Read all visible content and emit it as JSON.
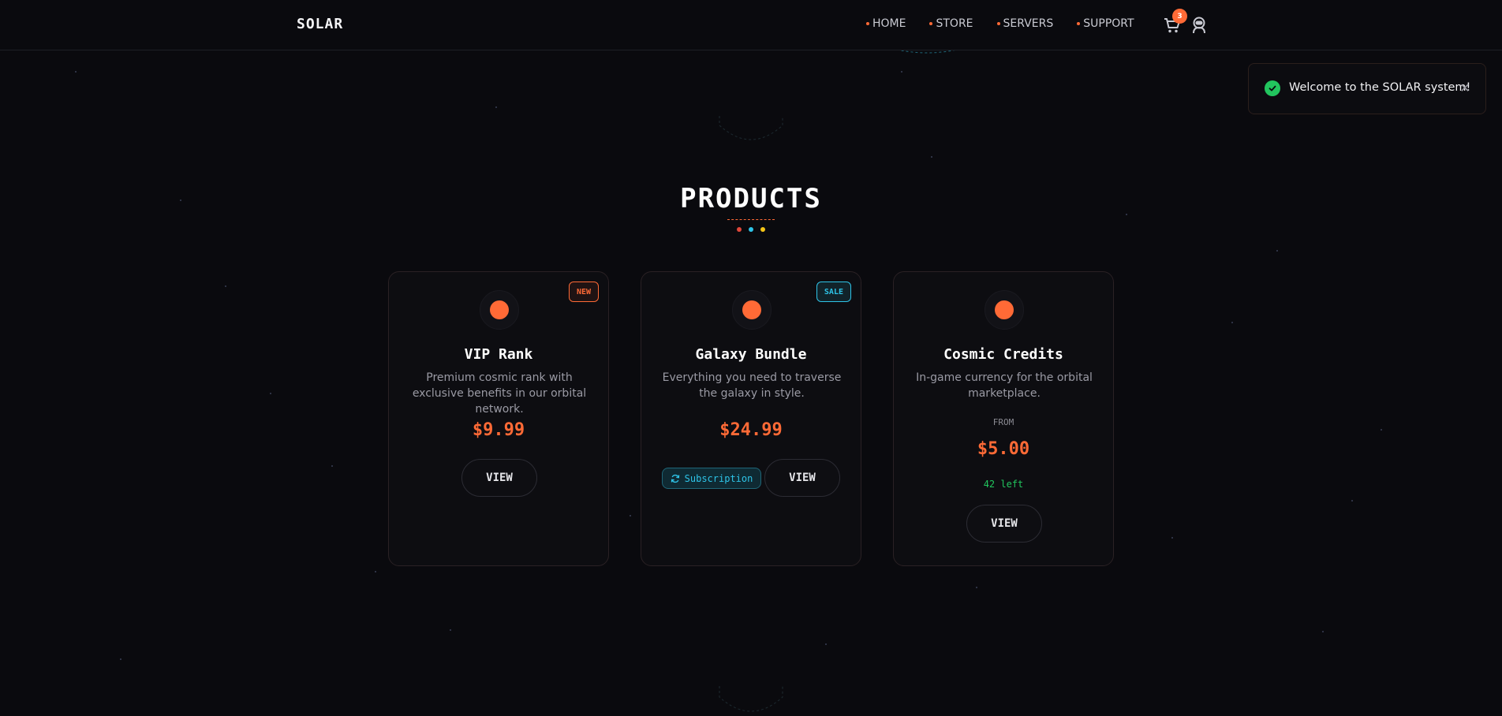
{
  "header": {
    "brand": "SOLAR",
    "nav": [
      {
        "label": "HOME"
      },
      {
        "label": "STORE"
      },
      {
        "label": "SERVERS"
      },
      {
        "label": "SUPPORT"
      }
    ],
    "cart_count": "3",
    "cart_icon": "cart-icon",
    "user_icon": "astronaut-icon"
  },
  "toast": {
    "message": "Welcome to the SOLAR system!",
    "close_label": "✕",
    "status_color": "#22c55e"
  },
  "section": {
    "title": "PRODUCTS",
    "dot_colors": [
      "#e0473a",
      "#2ec4e8",
      "#f5c518"
    ]
  },
  "products": [
    {
      "badge": "NEW",
      "title": "VIP Rank",
      "description": "Premium cosmic rank with exclusive benefits in our orbital network.",
      "price": "$9.99",
      "view_label": "VIEW"
    },
    {
      "badge": "SALE",
      "title": "Galaxy Bundle",
      "description": "Everything you need to traverse the galaxy in style.",
      "price": "$24.99",
      "subscription_label": "Subscription",
      "view_label": "VIEW"
    },
    {
      "title": "Cosmic Credits",
      "description": "In-game currency for the orbital marketplace.",
      "price_prefix": "FROM",
      "price": "$5.00",
      "stock": "42 left",
      "view_label": "VIEW"
    }
  ],
  "colors": {
    "accent": "#ff6a36",
    "background": "#0a0a0e",
    "sale": "#2ec4e8",
    "success": "#22c55e"
  }
}
